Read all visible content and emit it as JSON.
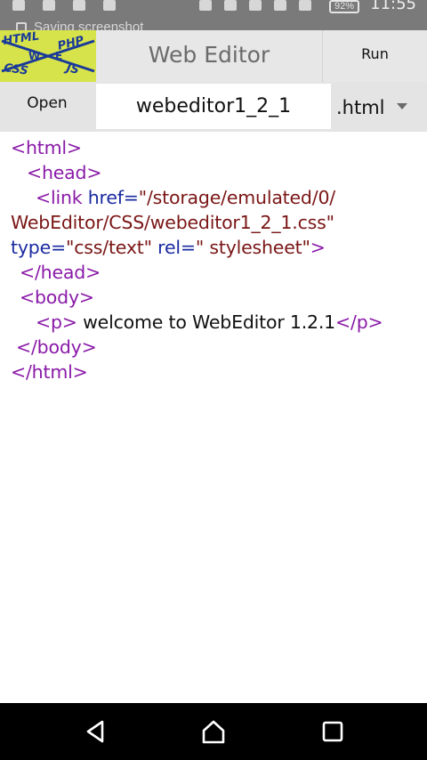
{
  "status_bar": {
    "notice": "Saving screenshot",
    "battery": "92%",
    "time": "11:55"
  },
  "app_bar": {
    "logo_words": [
      "HTML",
      "PHP",
      "W",
      "E",
      "CSS",
      "JS"
    ],
    "title": "Web Editor",
    "run_label": "Run"
  },
  "file_row": {
    "open_label": "Open",
    "filename": "webeditor1_2_1",
    "extension": ".html"
  },
  "code": {
    "l1_tag": "<html>",
    "l2_tag": "<head>",
    "l3_tag_open": "<link",
    "l3_attr_href": " href=",
    "l3_str_href_a": "\"/storage/emulated/0/",
    "l4_str_href_b": "WebEditor/CSS/webeditor1_2_1.css\"",
    "l5_attr_type": "type=",
    "l5_str_type": "\"css/text\"",
    "l5_attr_rel": " rel=",
    "l5_str_rel": "\" stylesheet\"",
    "l5_tag_close": ">",
    "l6_tag": "</head>",
    "l7_tag": "<body>",
    "l8_tag_p_open": "<p>",
    "l8_text": " welcome to WebEditor 1.2.1",
    "l8_tag_p_close": "</p>",
    "l9_tag": "</body>",
    "l10_tag": "</html>"
  },
  "nav_bar": {
    "back_icon": "back-triangle-icon",
    "home_icon": "home-icon",
    "recents_icon": "recents-square-icon"
  },
  "colors": {
    "tag": "#8a1aa8",
    "attribute": "#1a2aa0",
    "string": "#7a1616",
    "logo_bg": "#d7e34a"
  }
}
